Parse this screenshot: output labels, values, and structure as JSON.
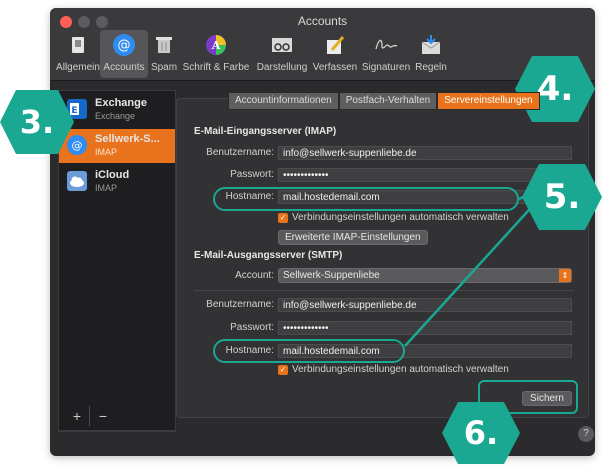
{
  "window": {
    "title": "Accounts"
  },
  "toolbar": {
    "items": [
      {
        "label": "Allgemein",
        "icon": "switch-icon"
      },
      {
        "label": "Accounts",
        "icon": "at-icon"
      },
      {
        "label": "Spam",
        "icon": "trash-icon"
      },
      {
        "label": "Schrift & Farbe",
        "icon": "palette-icon"
      },
      {
        "label": "Darstellung",
        "icon": "glasses-icon"
      },
      {
        "label": "Verfassen",
        "icon": "pencil-icon"
      },
      {
        "label": "Signaturen",
        "icon": "signature-icon"
      },
      {
        "label": "Regeln",
        "icon": "rules-icon"
      }
    ],
    "selected": "Accounts"
  },
  "sidebar": {
    "accounts": [
      {
        "name": "Exchange",
        "type": "Exchange",
        "icon": "exchange-icon"
      },
      {
        "name": "Sellwerk-S...",
        "type": "IMAP",
        "icon": "at-icon"
      },
      {
        "name": "iCloud",
        "type": "IMAP",
        "icon": "icloud-icon"
      }
    ],
    "add_label": "+",
    "remove_label": "−"
  },
  "tabs": [
    "Accountinformationen",
    "Postfach-Verhalten",
    "Servereinstellungen"
  ],
  "incoming": {
    "heading": "E-Mail-Eingangsserver (IMAP)",
    "username_label": "Benutzername:",
    "username": "info@sellwerk-suppenliebe.de",
    "password_label": "Passwort:",
    "password": "•••••••••••••",
    "hostname_label": "Hostname:",
    "hostname": "mail.hostedemail.com",
    "auto_manage": "Verbindungseinstellungen automatisch verwalten",
    "advanced_button": "Erweiterte IMAP-Einstellungen"
  },
  "outgoing": {
    "heading": "E-Mail-Ausgangsserver (SMTP)",
    "account_label": "Account:",
    "account": "Sellwerk-Suppenliebe",
    "username_label": "Benutzername:",
    "username": "info@sellwerk-suppenliebe.de",
    "password_label": "Passwort:",
    "password": "•••••••••••••",
    "hostname_label": "Hostname:",
    "hostname": "mail.hostedemail.com",
    "auto_manage": "Verbindungseinstellungen automatisch verwalten"
  },
  "save_button": "Sichern",
  "help_label": "?",
  "badges": [
    "3.",
    "4.",
    "5.",
    "6."
  ],
  "colors": {
    "accent": "#e8731c",
    "annotation": "#1aa893"
  }
}
